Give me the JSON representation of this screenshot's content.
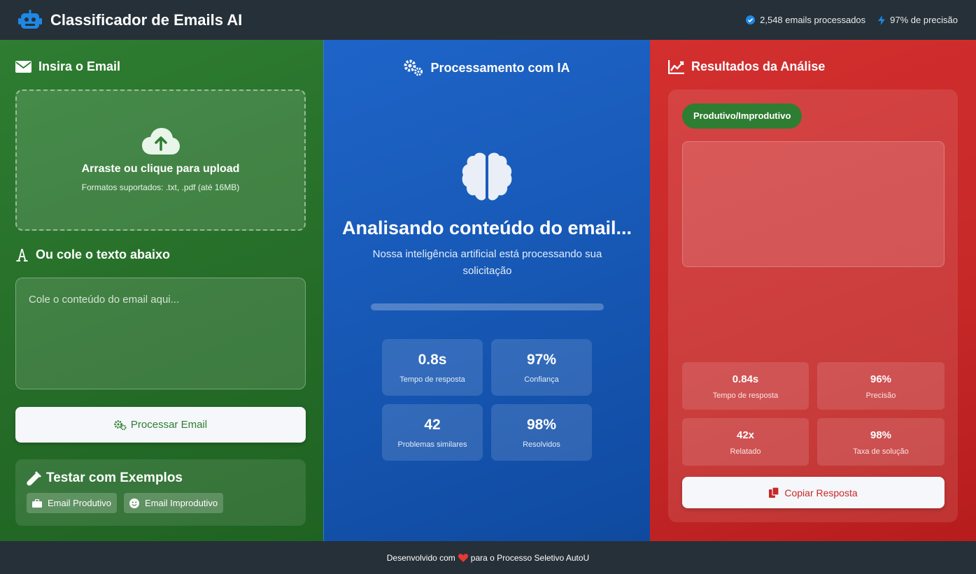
{
  "header": {
    "title": "Classificador de Emails AI",
    "stat_processed": "2,548 emails processados",
    "stat_precision": "97% de precisão"
  },
  "input": {
    "heading": "Insira o Email",
    "upload_title": "Arraste ou clique para upload",
    "upload_formats": "Formatos suportados: .txt, .pdf (até 16MB)",
    "paste_heading": "Ou cole o texto abaixo",
    "textarea_placeholder": "Cole o conteúdo do email aqui...",
    "process_button": "Processar Email",
    "examples_heading": "Testar com Exemplos",
    "example_productive": "Email Produtivo",
    "example_unproductive": "Email Improdutivo"
  },
  "processing": {
    "heading": "Processamento com IA",
    "analyzing_title": "Analisando conteúdo do email...",
    "analyzing_sub": "Nossa inteligência artificial está processando sua solicitação",
    "progress": 0,
    "stats": [
      {
        "value": "0.8s",
        "label": "Tempo de resposta"
      },
      {
        "value": "97%",
        "label": "Confiança"
      },
      {
        "value": "42",
        "label": "Problemas similares"
      },
      {
        "value": "98%",
        "label": "Resolvidos"
      }
    ]
  },
  "results": {
    "heading": "Resultados da Análise",
    "badge": "Produtivo/Improdutivo",
    "stats": [
      {
        "value": "0.84s",
        "label": "Tempo de resposta"
      },
      {
        "value": "96%",
        "label": "Precisão"
      },
      {
        "value": "42x",
        "label": "Relatado"
      },
      {
        "value": "98%",
        "label": "Taxa de solução"
      }
    ],
    "copy_button": "Copiar Resposta"
  },
  "footer": {
    "text_before": "Desenvolvido com",
    "text_after": "para o Processo Seletivo AutoU"
  },
  "colors": {
    "green": "#2e7d32",
    "blue": "#1758b5",
    "red": "#c62828",
    "dark": "#263038"
  }
}
